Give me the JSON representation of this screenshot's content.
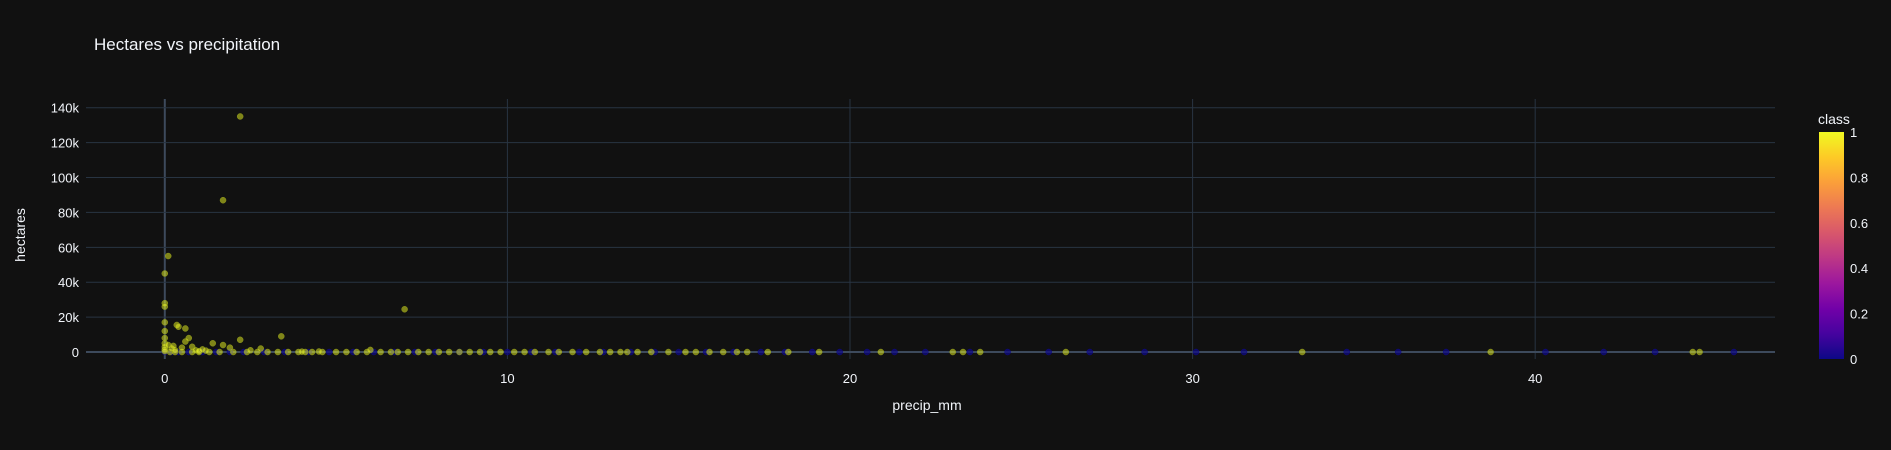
{
  "chart_data": {
    "type": "scatter",
    "title": "Hectares vs precipitation",
    "xlabel": "precip_mm",
    "ylabel": "hectares",
    "xlim": [
      -2.3,
      47
    ],
    "ylim": [
      -4000,
      145000
    ],
    "x_ticks": [
      0,
      10,
      20,
      30,
      40
    ],
    "y_ticks": [
      0,
      20000,
      40000,
      60000,
      80000,
      100000,
      120000,
      140000
    ],
    "y_tick_labels": [
      "0",
      "20k",
      "40k",
      "60k",
      "80k",
      "100k",
      "120k",
      "140k"
    ],
    "grid": true,
    "colorbar": {
      "title": "class",
      "range": [
        0,
        1
      ],
      "ticks": [
        "0",
        "0.2",
        "0.4",
        "0.6",
        "0.8",
        "1"
      ],
      "colorscale": [
        "#0d0887",
        "#46039f",
        "#7201a8",
        "#9c179e",
        "#bd3786",
        "#d8576b",
        "#ed7953",
        "#fb9f3a",
        "#fdca26",
        "#f0f921"
      ]
    },
    "series": [
      {
        "class": 1,
        "points": [
          [
            0,
            45000
          ],
          [
            0,
            28000
          ],
          [
            0,
            26000
          ],
          [
            0,
            17000
          ],
          [
            0,
            12000
          ],
          [
            0,
            8000
          ],
          [
            0,
            5000
          ],
          [
            0,
            3000
          ],
          [
            0,
            1500
          ],
          [
            0,
            500
          ],
          [
            0.1,
            55000
          ],
          [
            0.1,
            4000
          ],
          [
            0.2,
            2000
          ],
          [
            0.3,
            1000
          ],
          [
            0.35,
            15500
          ],
          [
            0.4,
            14500
          ],
          [
            0.6,
            13500
          ],
          [
            0.6,
            6000
          ],
          [
            0.7,
            8000
          ],
          [
            0.8,
            3000
          ],
          [
            0.9,
            1000
          ],
          [
            1.0,
            500
          ],
          [
            1.2,
            800
          ],
          [
            1.4,
            5000
          ],
          [
            1.7,
            87000
          ],
          [
            1.7,
            4000
          ],
          [
            1.9,
            2500
          ],
          [
            2.2,
            135000
          ],
          [
            2.2,
            7000
          ],
          [
            2.8,
            2000
          ],
          [
            3.4,
            9000
          ],
          [
            7.0,
            24500
          ],
          [
            6.0,
            1200
          ],
          [
            0.5,
            2500
          ],
          [
            0.25,
            3500
          ],
          [
            1.1,
            1500
          ],
          [
            2.5,
            1000
          ],
          [
            4.0,
            200
          ],
          [
            4.5,
            300
          ]
        ]
      },
      {
        "class": 1,
        "points_on_zero": [
          0.15,
          0.3,
          0.5,
          0.8,
          1.0,
          1.3,
          1.6,
          2.0,
          2.4,
          2.7,
          3.0,
          3.3,
          3.6,
          3.9,
          4.1,
          4.3,
          4.6,
          5.0,
          5.3,
          5.6,
          5.9,
          6.3,
          6.6,
          6.8,
          7.1,
          7.4,
          7.7,
          8.0,
          8.3,
          8.6,
          8.9,
          9.2,
          9.5,
          9.8,
          10.2,
          10.5,
          10.8,
          11.2,
          11.5,
          11.9,
          12.3,
          12.7,
          13.0,
          13.3,
          13.5,
          13.8,
          14.2,
          14.7,
          15.2,
          15.5,
          15.9,
          16.3,
          16.7,
          17.0,
          17.6,
          18.2,
          19.1,
          20.9,
          23.0,
          23.3,
          23.8,
          26.3,
          33.2,
          38.7,
          44.6,
          44.8
        ]
      },
      {
        "class": 0,
        "points_on_zero": [
          0.0,
          0.2,
          0.4,
          0.7,
          1.1,
          1.5,
          1.9,
          2.3,
          2.9,
          3.5,
          4.2,
          4.8,
          5.5,
          6.1,
          6.7,
          7.3,
          7.9,
          8.6,
          9.3,
          10.0,
          10.7,
          11.4,
          12.1,
          12.8,
          13.6,
          14.3,
          15.0,
          15.8,
          16.6,
          17.4,
          18.1,
          18.9,
          19.7,
          20.5,
          21.3,
          22.2,
          23.5,
          24.6,
          25.8,
          27.0,
          28.6,
          30.1,
          31.5,
          34.5,
          36.0,
          37.4,
          40.3,
          42.0,
          43.5,
          45.8
        ]
      }
    ]
  }
}
